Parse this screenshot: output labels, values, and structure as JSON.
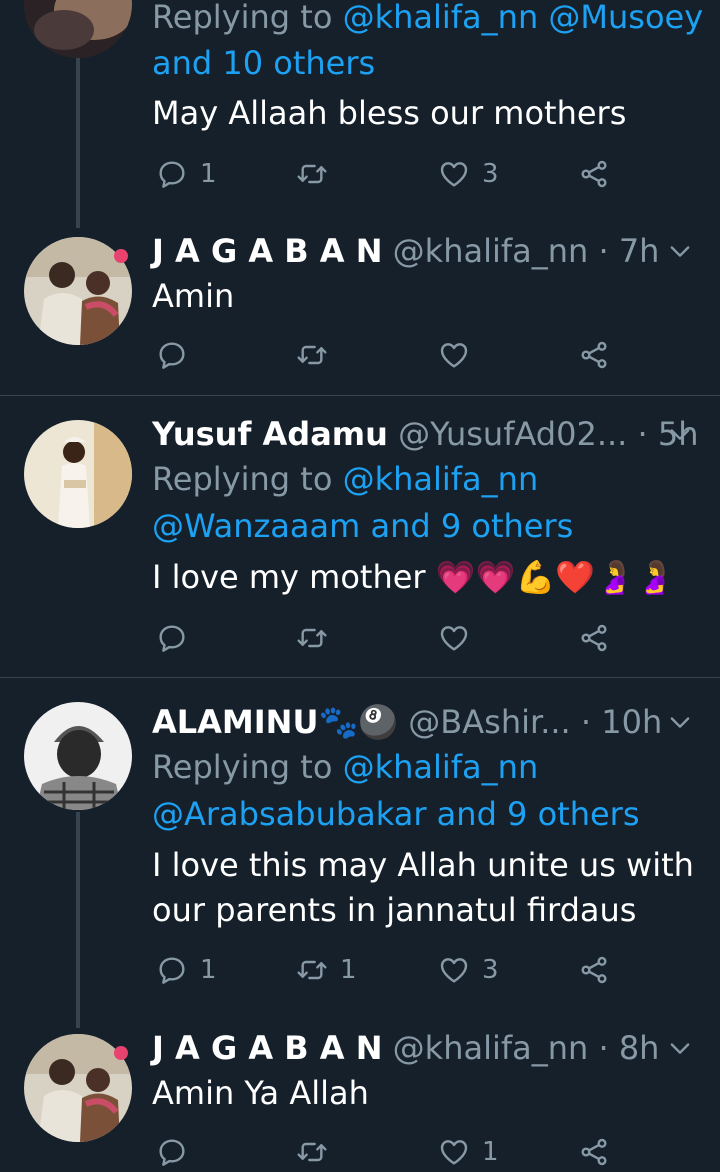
{
  "theme": {
    "background": "#15202b",
    "text": "#ffffff",
    "muted": "#8899a6",
    "link": "#1da1f2",
    "divider": "#38444d"
  },
  "tweets": [
    {
      "reply_to_prefix": "Replying to ",
      "reply_to_mentions": "@khalifa_nn @Musoey",
      "reply_to_others": "and 10 others",
      "text": "May Allaah bless our mothers",
      "replies": "1",
      "retweets": "",
      "likes": "3"
    },
    {
      "name": "J A G A B A N",
      "handle": "@khalifa_nn",
      "separator": "·",
      "time": "7h",
      "text": "Amin",
      "replies": "",
      "retweets": "",
      "likes": ""
    },
    {
      "name": "Yusuf Adamu",
      "handle": "@YusufAd02...",
      "separator": "·",
      "time": "5h",
      "reply_to_prefix": "Replying to ",
      "reply_to_mentions": "@khalifa_nn",
      "reply_to_line2": "@Wanzaaam and 9 others",
      "text": "I love my mother 💗💗💪❤️🤰🤰",
      "replies": "",
      "retweets": "",
      "likes": ""
    },
    {
      "name": "ALAMINU🐾🎱",
      "handle": "@BAshir...",
      "separator": "·",
      "time": "10h",
      "reply_to_prefix": "Replying to ",
      "reply_to_mentions": "@khalifa_nn",
      "reply_to_line2": "@Arabsabubakar and 9 others",
      "text_line1": "I love this may Allah unite us with",
      "text_line2": "our parents in jannatul firdaus",
      "replies": "1",
      "retweets": "1",
      "likes": "3"
    },
    {
      "name": "J A G A B A N",
      "handle": "@khalifa_nn",
      "separator": "·",
      "time": "8h",
      "text": "Amin Ya Allah",
      "replies": "",
      "retweets": "",
      "likes": "1"
    }
  ]
}
